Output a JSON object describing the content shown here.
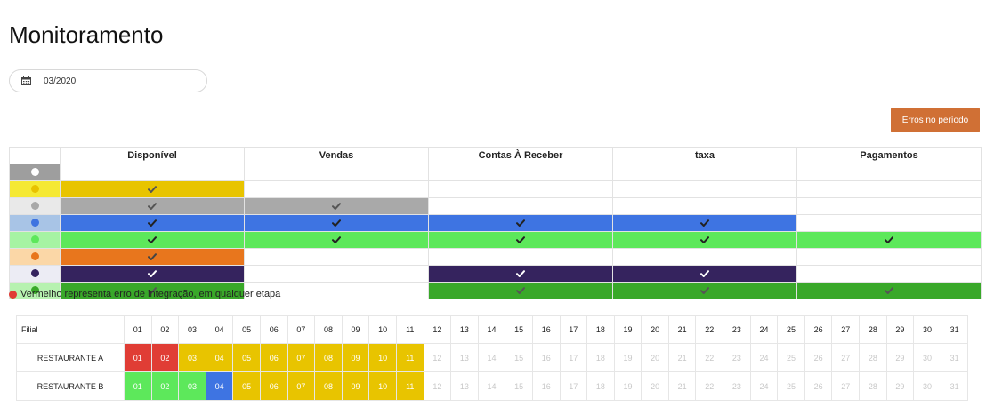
{
  "page": {
    "title": "Monitoramento"
  },
  "filter": {
    "date_value": "03/2020",
    "calendar_icon": "calendar-icon"
  },
  "actions": {
    "errors_button": "Erros no período",
    "errors_button_color": "#d07035"
  },
  "legend": {
    "columns": [
      "Disponível",
      "Vendas",
      "Contas À Receber",
      "taxa",
      "Pagamentos"
    ],
    "rows": [
      {
        "dot": "#ffffff",
        "bg": "#9e9e9e",
        "fill": "",
        "checks": [
          false,
          false,
          false,
          false,
          false
        ],
        "check_color": "#555555"
      },
      {
        "dot": "#e8c200",
        "bg": "#f5e933",
        "fill": "#e8c400",
        "checks": [
          true,
          false,
          false,
          false,
          false
        ],
        "check_color": "#555555"
      },
      {
        "dot": "#a8a8a8",
        "bg": "#e9e9e9",
        "fill": "#a9a9a9",
        "checks": [
          true,
          true,
          false,
          false,
          false
        ],
        "check_color": "#555555"
      },
      {
        "dot": "#3f74e0",
        "bg": "#a8c4e6",
        "fill": "#3e74e2",
        "checks": [
          true,
          true,
          true,
          true,
          false
        ],
        "check_color": "#222222"
      },
      {
        "dot": "#5de85b",
        "bg": "#a6f3a3",
        "fill": "#5de85b",
        "checks": [
          true,
          true,
          true,
          true,
          true
        ],
        "check_color": "#222222"
      },
      {
        "dot": "#e8761d",
        "bg": "#fbd7a7",
        "fill": "#e8761d",
        "checks": [
          true,
          false,
          false,
          false,
          false
        ],
        "check_color": "#444444"
      },
      {
        "dot": "#35235e",
        "bg": "#ececf4",
        "fill": "#35235e",
        "checks": [
          true,
          false,
          true,
          true,
          false
        ],
        "check_color": "#ffffff"
      },
      {
        "dot": "#39a829",
        "bg": "#b7f2b0",
        "fill": "#39a829",
        "checks": [
          true,
          false,
          true,
          true,
          true
        ],
        "check_color": "#555555"
      }
    ]
  },
  "note": {
    "text": "Vermelho representa erro de integração, em qualquer etapa",
    "color": "#e03d35"
  },
  "days_table": {
    "filial_header": "Filial",
    "days": [
      "01",
      "02",
      "03",
      "04",
      "05",
      "06",
      "07",
      "08",
      "09",
      "10",
      "11",
      "12",
      "13",
      "14",
      "15",
      "16",
      "17",
      "18",
      "19",
      "20",
      "21",
      "22",
      "23",
      "24",
      "25",
      "26",
      "27",
      "28",
      "29",
      "30",
      "31"
    ],
    "colors": {
      "red": "#e03d35",
      "yellow": "#e8c400",
      "green": "#5de85b",
      "blue": "#3e74e2",
      "empty": ""
    },
    "rows": [
      {
        "name": "RESTAURANTE A",
        "statuses": [
          "red",
          "red",
          "yellow",
          "yellow",
          "yellow",
          "yellow",
          "yellow",
          "yellow",
          "yellow",
          "yellow",
          "yellow",
          "empty",
          "empty",
          "empty",
          "empty",
          "empty",
          "empty",
          "empty",
          "empty",
          "empty",
          "empty",
          "empty",
          "empty",
          "empty",
          "empty",
          "empty",
          "empty",
          "empty",
          "empty",
          "empty",
          "empty"
        ]
      },
      {
        "name": "RESTAURANTE B",
        "statuses": [
          "green",
          "green",
          "green",
          "blue",
          "yellow",
          "yellow",
          "yellow",
          "yellow",
          "yellow",
          "yellow",
          "yellow",
          "empty",
          "empty",
          "empty",
          "empty",
          "empty",
          "empty",
          "empty",
          "empty",
          "empty",
          "empty",
          "empty",
          "empty",
          "empty",
          "empty",
          "empty",
          "empty",
          "empty",
          "empty",
          "empty",
          "empty"
        ]
      }
    ]
  }
}
